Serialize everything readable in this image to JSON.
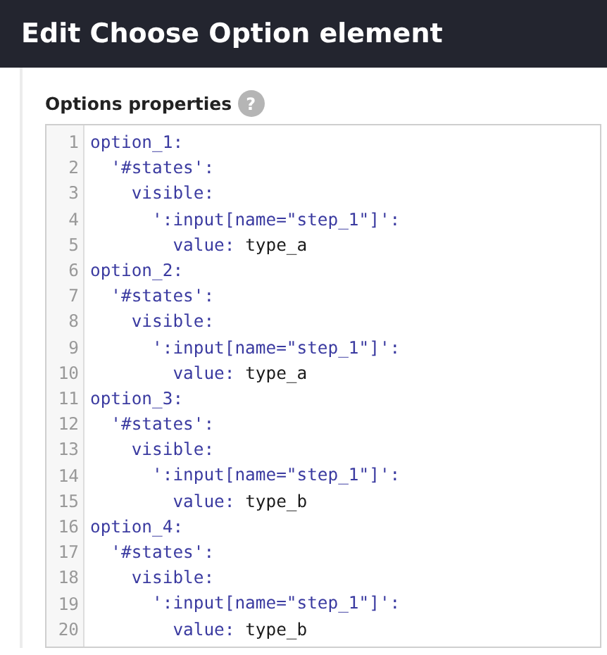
{
  "window": {
    "title": "Edit Choose Option element"
  },
  "field": {
    "label": "Options properties",
    "help": "?"
  },
  "code_lines": [
    {
      "number": "1",
      "key": "option_1:"
    },
    {
      "number": "2",
      "key": "  '#states':"
    },
    {
      "number": "3",
      "key": "    visible:"
    },
    {
      "number": "4",
      "key": "      ':input[name=\"step_1\"]':"
    },
    {
      "number": "5",
      "key": "        value:",
      "value": "type_a"
    },
    {
      "number": "6",
      "key": "option_2:"
    },
    {
      "number": "7",
      "key": "  '#states':"
    },
    {
      "number": "8",
      "key": "    visible:"
    },
    {
      "number": "9",
      "key": "      ':input[name=\"step_1\"]':"
    },
    {
      "number": "10",
      "key": "        value:",
      "value": "type_a"
    },
    {
      "number": "11",
      "key": "option_3:"
    },
    {
      "number": "12",
      "key": "  '#states':"
    },
    {
      "number": "13",
      "key": "    visible:"
    },
    {
      "number": "14",
      "key": "      ':input[name=\"step_1\"]':"
    },
    {
      "number": "15",
      "key": "        value:",
      "value": "type_b"
    },
    {
      "number": "16",
      "key": "option_4:"
    },
    {
      "number": "17",
      "key": "  '#states':"
    },
    {
      "number": "18",
      "key": "    visible:"
    },
    {
      "number": "19",
      "key": "      ':input[name=\"step_1\"]':"
    },
    {
      "number": "20",
      "key": "        value:",
      "value": "type_b"
    }
  ]
}
